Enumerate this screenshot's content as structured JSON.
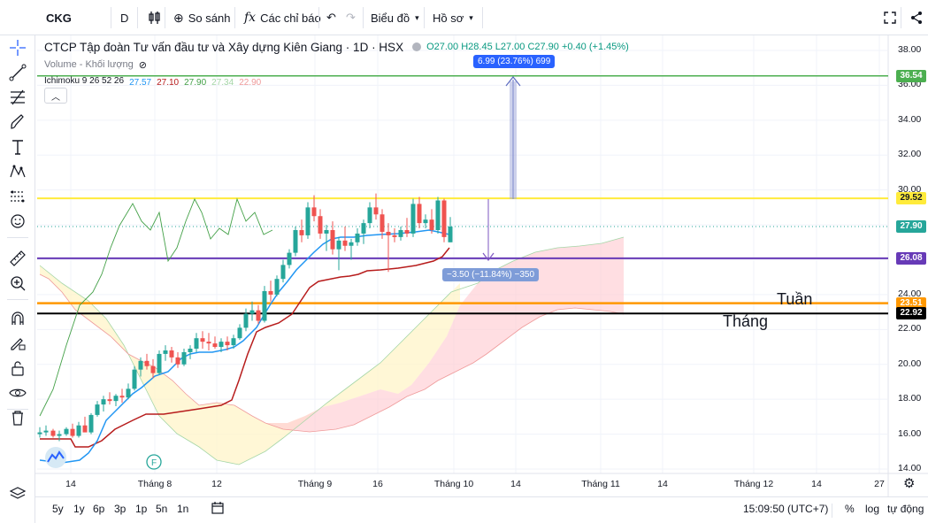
{
  "toolbar": {
    "symbol": "CKG",
    "interval": "D",
    "compare_label": "So sánh",
    "indicators_label": "Các chỉ báo",
    "layout_label": "Biểu đồ",
    "profile_label": "Hồ sơ"
  },
  "legend": {
    "title": "CTCP Tập đoàn Tư vấn đầu tư và Xây dựng Kiên Giang · 1D · HSX",
    "ohlc": "O27.00  H28.45  L27.00  C27.90  +0.40 (+1.45%)",
    "volume_label": "Volume - Khối lượng",
    "ichimoku_label": "Ichimoku 9 26 52 26",
    "ichimoku_values": [
      {
        "text": "27.57",
        "color": "#2196f3"
      },
      {
        "text": "27.10",
        "color": "#b71c1c"
      },
      {
        "text": "27.90",
        "color": "#43a047"
      },
      {
        "text": "27.34",
        "color": "#a5d6a7"
      },
      {
        "text": "22.90",
        "color": "#ef9a9a"
      }
    ]
  },
  "price_axis": {
    "ticks": [
      "38.00",
      "36.00",
      "34.00",
      "32.00",
      "30.00",
      "24.00",
      "22.00",
      "20.00",
      "18.00",
      "16.00",
      "14.00"
    ],
    "badges": [
      {
        "text": "36.54",
        "bg": "#4caf50",
        "fg": "#ffffff"
      },
      {
        "text": "29.52",
        "bg": "#ffeb3b",
        "fg": "#131722"
      },
      {
        "text": "27.90",
        "bg": "#26a69a",
        "fg": "#ffffff"
      },
      {
        "text": "26.08",
        "bg": "#673ab7",
        "fg": "#ffffff"
      },
      {
        "text": "23.51",
        "bg": "#ff9800",
        "fg": "#ffffff"
      },
      {
        "text": "22.92",
        "bg": "#000000",
        "fg": "#ffffff"
      }
    ]
  },
  "time_axis": [
    "14",
    "Tháng 8",
    "12",
    "Tháng 9",
    "16",
    "Tháng 10",
    "14",
    "Tháng 11",
    "14",
    "Tháng 12",
    "14",
    "27"
  ],
  "measure": {
    "up": "6.99 (23.76%) 699",
    "down": "−3.50 (−11.84%) −350"
  },
  "annotations": {
    "week": "Tuần",
    "month": "Tháng"
  },
  "bottom": {
    "ranges": [
      "5y",
      "1y",
      "6p",
      "3p",
      "1p",
      "5n",
      "1n"
    ],
    "time": "15:09:50 (UTC+7)",
    "percent": "%",
    "log": "log",
    "auto": "tự động"
  },
  "colors": {
    "up": "#26a69a",
    "down": "#ef5350",
    "tenkan": "#2196f3",
    "kijun": "#b71c1c",
    "chikou": "#43a047"
  },
  "chart_data": {
    "type": "candlestick",
    "price_range": [
      14,
      39
    ],
    "horizontal_levels": [
      36.54,
      29.52,
      26.08,
      23.51,
      22.92
    ],
    "last_close": 27.9
  }
}
